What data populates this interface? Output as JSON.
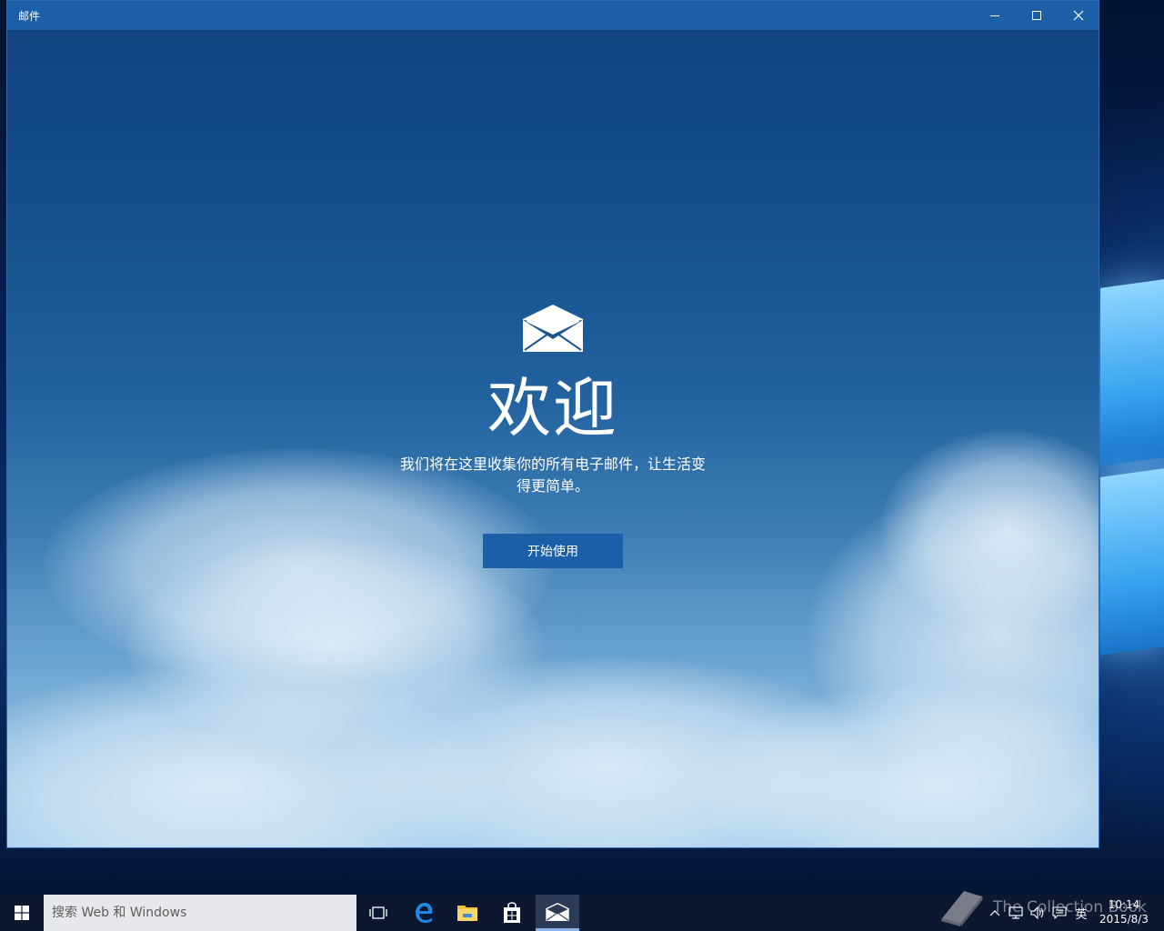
{
  "window": {
    "title": "邮件"
  },
  "welcome": {
    "title": "欢迎",
    "description": "我们将在这里收集你的所有电子邮件，让生活变得更简单。",
    "start_button_label": "开始使用"
  },
  "taskbar": {
    "search_placeholder": "搜索 Web 和 Windows",
    "input_language": "英",
    "time": "10:14",
    "date": "2015/8/3"
  },
  "watermark": {
    "text": "The Collection Book"
  },
  "colors": {
    "title_bar": "#1d5fa6",
    "accent_button": "#1a5fa8",
    "taskbar": "#0c1830",
    "search_box": "#e6e8ec"
  },
  "icons": {
    "start": "windows-logo-icon",
    "task_view": "task-view-icon",
    "browser": "edge-browser-icon",
    "explorer": "file-explorer-icon",
    "store": "store-icon",
    "mail": "mail-icon"
  }
}
